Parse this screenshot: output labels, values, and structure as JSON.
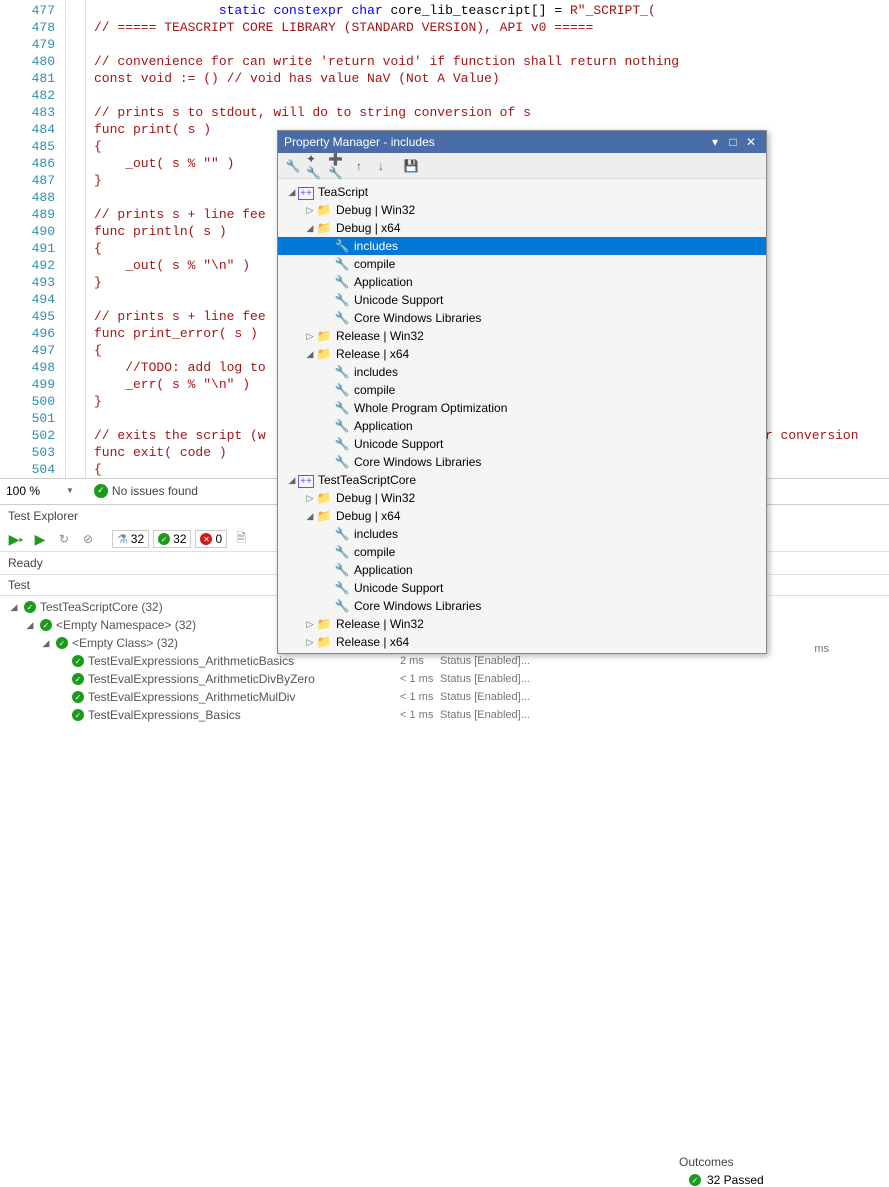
{
  "editor": {
    "lines": [
      {
        "n": 477,
        "indent": "                ",
        "html": "<span class='kw'>static</span> <span class='kw'>constexpr</span> <span class='kw'>char</span> core_lib_teascript[] = <span class='str'>R\"_SCRIPT_(</span>"
      },
      {
        "n": 478,
        "indent": "",
        "html": "<span class='raw'>// ===== TEASCRIPT CORE LIBRARY (STANDARD VERSION), API v0 =====</span>"
      },
      {
        "n": 479,
        "indent": "",
        "html": ""
      },
      {
        "n": 480,
        "indent": "",
        "html": "<span class='raw'>// convenience for can write 'return void' if function shall return nothing</span>"
      },
      {
        "n": 481,
        "indent": "",
        "html": "<span class='raw'>const void := () // void has value NaV (Not A Value)</span>"
      },
      {
        "n": 482,
        "indent": "",
        "html": ""
      },
      {
        "n": 483,
        "indent": "",
        "html": "<span class='raw'>// prints s to stdout, will do to string conversion of s</span>"
      },
      {
        "n": 484,
        "indent": "",
        "html": "<span class='raw'>func print( s )</span>"
      },
      {
        "n": 485,
        "indent": "",
        "html": "<span class='raw'>{</span>"
      },
      {
        "n": 486,
        "indent": "",
        "html": "<span class='raw'>    _out( s % \"\" )</span>"
      },
      {
        "n": 487,
        "indent": "",
        "html": "<span class='raw'>}</span>"
      },
      {
        "n": 488,
        "indent": "",
        "html": ""
      },
      {
        "n": 489,
        "indent": "",
        "html": "<span class='raw'>// prints s + line fee</span>"
      },
      {
        "n": 490,
        "indent": "",
        "html": "<span class='raw'>func println( s )</span>"
      },
      {
        "n": 491,
        "indent": "",
        "html": "<span class='raw'>{</span>"
      },
      {
        "n": 492,
        "indent": "",
        "html": "<span class='raw'>    _out( s % \"\\n\" )</span>"
      },
      {
        "n": 493,
        "indent": "",
        "html": "<span class='raw'>}</span>"
      },
      {
        "n": 494,
        "indent": "",
        "html": ""
      },
      {
        "n": 495,
        "indent": "",
        "html": "<span class='raw'>// prints s + line fee</span>"
      },
      {
        "n": 496,
        "indent": "",
        "html": "<span class='raw'>func print_error( s )</span>"
      },
      {
        "n": 497,
        "indent": "",
        "html": "<span class='raw'>{</span>"
      },
      {
        "n": 498,
        "indent": "",
        "html": "<span class='raw'>    //TODO: add log to</span>"
      },
      {
        "n": 499,
        "indent": "",
        "html": "<span class='raw'>    _err( s % \"\\n\" )</span>"
      },
      {
        "n": 500,
        "indent": "",
        "html": "<span class='raw'>}</span>"
      },
      {
        "n": 501,
        "indent": "",
        "html": ""
      },
      {
        "n": 502,
        "indent": "",
        "html": "<span class='raw'>// exits the script (w                                                             mber conversion </span>"
      },
      {
        "n": 503,
        "indent": "",
        "html": "<span class='raw'>func exit( code )</span>"
      },
      {
        "n": 504,
        "indent": "",
        "html": "<span class='raw'>{</span>"
      }
    ]
  },
  "status": {
    "zoom": "100 %",
    "issues": "No issues found"
  },
  "testExplorer": {
    "title": "Test Explorer",
    "metrics": {
      "total": "32",
      "passed": "32",
      "failed": "0"
    },
    "ready": "Ready",
    "header": "Test",
    "rows": [
      {
        "depth": 0,
        "exp": "◢",
        "icon": "pass",
        "text": "TestTeaScriptCore  (32)",
        "dur": "",
        "stat": ""
      },
      {
        "depth": 1,
        "exp": "◢",
        "icon": "pass",
        "text": "<Empty Namespace>  (32)",
        "dur": "",
        "stat": ""
      },
      {
        "depth": 2,
        "exp": "◢",
        "icon": "pass",
        "text": "<Empty Class>  (32)",
        "dur": "",
        "stat": ""
      },
      {
        "depth": 3,
        "exp": "",
        "icon": "pass",
        "text": "TestEvalExpressions_ArithmeticBasics",
        "dur": "2 ms",
        "stat": "Status [Enabled]..."
      },
      {
        "depth": 3,
        "exp": "",
        "icon": "pass",
        "text": "TestEvalExpressions_ArithmeticDivByZero",
        "dur": "< 1 ms",
        "stat": "Status [Enabled]..."
      },
      {
        "depth": 3,
        "exp": "",
        "icon": "pass",
        "text": "TestEvalExpressions_ArithmeticMulDiv",
        "dur": "< 1 ms",
        "stat": "Status [Enabled]..."
      },
      {
        "depth": 3,
        "exp": "",
        "icon": "pass",
        "text": "TestEvalExpressions_Basics",
        "dur": "< 1 ms",
        "stat": "Status [Enabled]..."
      }
    ],
    "outcomes": {
      "header": "Outcomes",
      "passed": "32 Passed"
    },
    "trailing_ms": "  ms"
  },
  "pm": {
    "title": "Property Manager - includes",
    "tree": [
      {
        "depth": 0,
        "exp": "◢",
        "icon": "prj",
        "label": "TeaScript"
      },
      {
        "depth": 1,
        "exp": "▷",
        "icon": "folder",
        "label": "Debug | Win32"
      },
      {
        "depth": 1,
        "exp": "◢",
        "icon": "folder",
        "label": "Debug | x64"
      },
      {
        "depth": 2,
        "exp": "",
        "icon": "wrench",
        "label": "includes",
        "selected": true
      },
      {
        "depth": 2,
        "exp": "",
        "icon": "wrench",
        "label": "compile"
      },
      {
        "depth": 2,
        "exp": "",
        "icon": "wrench",
        "label": "Application"
      },
      {
        "depth": 2,
        "exp": "",
        "icon": "wrench",
        "label": "Unicode Support"
      },
      {
        "depth": 2,
        "exp": "",
        "icon": "wrench",
        "label": "Core Windows Libraries"
      },
      {
        "depth": 1,
        "exp": "▷",
        "icon": "folder",
        "label": "Release | Win32"
      },
      {
        "depth": 1,
        "exp": "◢",
        "icon": "folder",
        "label": "Release | x64"
      },
      {
        "depth": 2,
        "exp": "",
        "icon": "wrench",
        "label": "includes"
      },
      {
        "depth": 2,
        "exp": "",
        "icon": "wrench",
        "label": "compile"
      },
      {
        "depth": 2,
        "exp": "",
        "icon": "wrench",
        "label": "Whole Program Optimization"
      },
      {
        "depth": 2,
        "exp": "",
        "icon": "wrench",
        "label": "Application"
      },
      {
        "depth": 2,
        "exp": "",
        "icon": "wrench",
        "label": "Unicode Support"
      },
      {
        "depth": 2,
        "exp": "",
        "icon": "wrench",
        "label": "Core Windows Libraries"
      },
      {
        "depth": 0,
        "exp": "◢",
        "icon": "prj",
        "label": "TestTeaScriptCore"
      },
      {
        "depth": 1,
        "exp": "▷",
        "icon": "folder",
        "label": "Debug | Win32"
      },
      {
        "depth": 1,
        "exp": "◢",
        "icon": "folder",
        "label": "Debug | x64"
      },
      {
        "depth": 2,
        "exp": "",
        "icon": "wrench",
        "label": "includes"
      },
      {
        "depth": 2,
        "exp": "",
        "icon": "wrench",
        "label": "compile"
      },
      {
        "depth": 2,
        "exp": "",
        "icon": "wrench",
        "label": "Application"
      },
      {
        "depth": 2,
        "exp": "",
        "icon": "wrench",
        "label": "Unicode Support"
      },
      {
        "depth": 2,
        "exp": "",
        "icon": "wrench",
        "label": "Core Windows Libraries"
      },
      {
        "depth": 1,
        "exp": "▷",
        "icon": "folder",
        "label": "Release | Win32"
      },
      {
        "depth": 1,
        "exp": "▷",
        "icon": "folder",
        "label": "Release | x64"
      }
    ]
  }
}
